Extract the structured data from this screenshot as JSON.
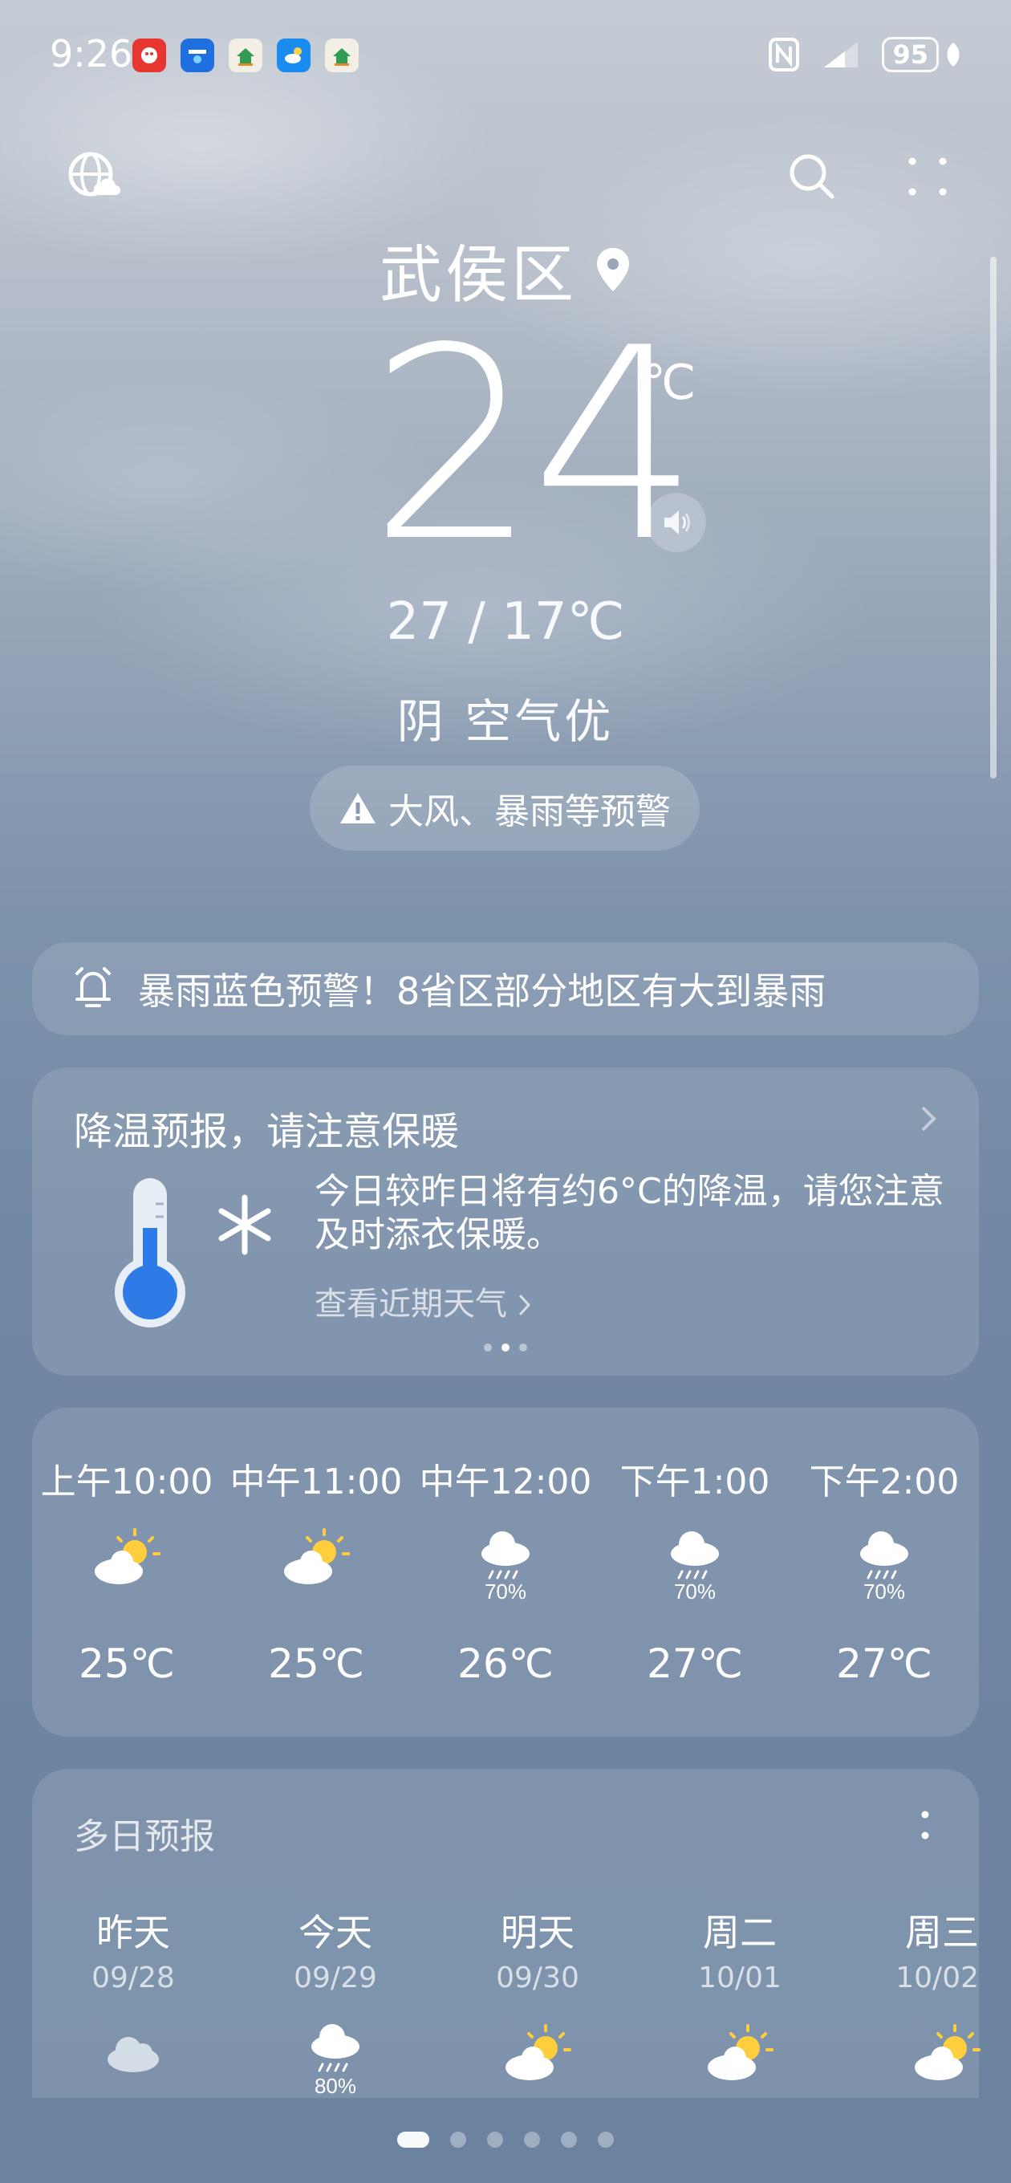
{
  "status": {
    "time": "9:26",
    "battery": "95",
    "app_icons": [
      "app-red-icon",
      "app-autohome-icon",
      "app-house-icon",
      "app-cloud-icon",
      "app-house2-icon"
    ]
  },
  "location": {
    "city": "武侯区"
  },
  "current": {
    "temp": "24",
    "unit": "℃",
    "range": "27 / 17℃",
    "condition": "阴  空气优",
    "warning_pill": "大风、暴雨等预警"
  },
  "alert": {
    "text": "暴雨蓝色预警！8省区部分地区有大到暴雨"
  },
  "notice": {
    "title": "降温预报，请注意保暖",
    "body": "今日较昨日将有约6°C的降温，请您注意及时添衣保暖。",
    "link": "查看近期天气",
    "page_index": 2,
    "page_count": 3
  },
  "hourly": [
    {
      "time": "上午10:00",
      "icon": "sun-cloud-icon",
      "temp": "25℃",
      "pop": ""
    },
    {
      "time": "中午11:00",
      "icon": "sun-cloud-icon",
      "temp": "25℃",
      "pop": ""
    },
    {
      "time": "中午12:00",
      "icon": "rain-icon",
      "temp": "26℃",
      "pop": "70%"
    },
    {
      "time": "下午1:00",
      "icon": "rain-icon",
      "temp": "27℃",
      "pop": "70%"
    },
    {
      "time": "下午2:00",
      "icon": "rain-icon",
      "temp": "27℃",
      "pop": "70%"
    }
  ],
  "daily": {
    "title": "多日预报",
    "days": [
      {
        "name": "昨天",
        "date": "09/28",
        "icon": "cloud-icon",
        "pop": ""
      },
      {
        "name": "今天",
        "date": "09/29",
        "icon": "rain-icon",
        "pop": "80%"
      },
      {
        "name": "明天",
        "date": "09/30",
        "icon": "sun-cloud-icon",
        "pop": ""
      },
      {
        "name": "周二",
        "date": "10/01",
        "icon": "sun-cloud-icon",
        "pop": ""
      },
      {
        "name": "周三",
        "date": "10/02",
        "icon": "sun-cloud-icon",
        "pop": ""
      }
    ]
  },
  "pager": {
    "count": 6,
    "active": 1
  }
}
